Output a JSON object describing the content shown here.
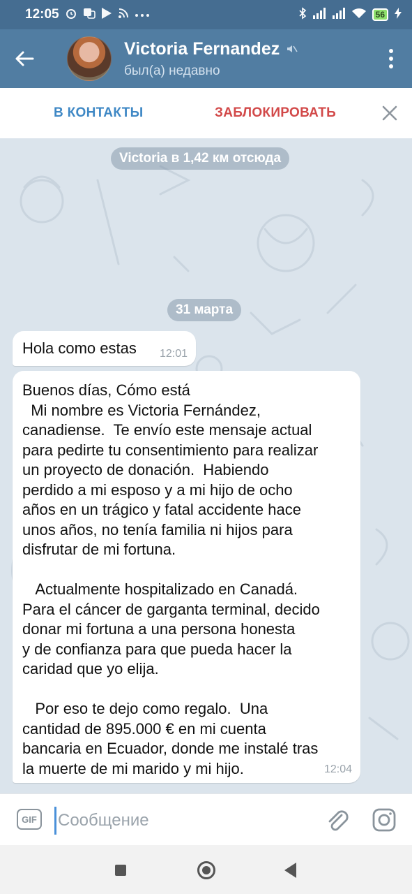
{
  "status_bar": {
    "time": "12:05",
    "battery_level": "56",
    "icons": [
      "alarm-icon",
      "translate-icon",
      "play-store-icon",
      "rss-icon",
      "more-dots-icon",
      "bluetooth-icon",
      "signal-icon",
      "signal-icon",
      "wifi-icon",
      "battery-icon",
      "charging-icon"
    ]
  },
  "header": {
    "contact_name": "Victoria Fernandez",
    "status": "был(а) недавно",
    "icons": [
      "back-arrow-icon",
      "avatar",
      "muted-icon",
      "menu-dots-icon"
    ]
  },
  "action_bar": {
    "add_contact_label": "В КОНТАКТЫ",
    "block_label": "ЗАБЛОКИРОВАТЬ",
    "close_icon": "close-icon"
  },
  "chat": {
    "location_badge": "Victoria в 1,42 км отсюда",
    "date_badge": "31 марта",
    "messages": [
      {
        "text": "Hola como estas",
        "time": "12:01"
      },
      {
        "text": "Buenos días, Cómo está\n  Mi nombre es Victoria Fernández,\ncanadiense.  Te envío este mensaje actual\npara pedirte tu consentimiento para realizar\nun proyecto de donación.  Habiendo\nperdido a mi esposo y a mi hijo de ocho\naños en un trágico y fatal accidente hace\nunos años, no tenía familia ni hijos para\ndisfrutar de mi fortuna.\n\n   Actualmente hospitalizado en Canadá.\nPara el cáncer de garganta terminal, decido\ndonar mi fortuna a una persona honesta\ny de confianza para que pueda hacer la\ncaridad que yo elija.\n\n   Por eso te dejo como regalo.  Una\ncantidad de 895.000 € en mi cuenta\nbancaria en Ecuador, donde me instalé tras\nla muerte de mi marido y mi hijo.",
        "time": "12:04"
      }
    ]
  },
  "input_bar": {
    "gif_label": "GIF",
    "placeholder": "Сообщение",
    "icons": [
      "gif-icon",
      "attach-icon",
      "camera-icon"
    ]
  },
  "nav_bar": {
    "icons": [
      "recent-apps-icon",
      "home-icon",
      "back-icon"
    ]
  },
  "colors": {
    "header": "#517da2",
    "status_bar": "#456d91",
    "accent_blue": "#3f88c5",
    "block_red": "#d24949",
    "chat_background": "#dbe4ec"
  }
}
